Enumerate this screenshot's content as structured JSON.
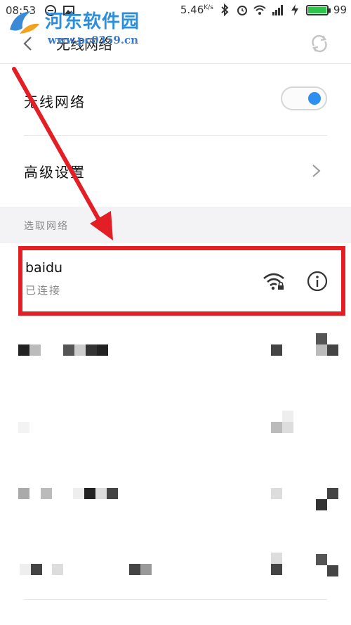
{
  "status_bar": {
    "time": "08:53",
    "net_speed": "5.46",
    "net_speed_unit": "K/s",
    "battery_level": "99",
    "battery_fraction": 0.99
  },
  "watermark": {
    "title": "河东软件园",
    "url": "www.pc0359.cn"
  },
  "header": {
    "title": "无线网络",
    "back_icon": "back-arrow-icon",
    "refresh_icon": "refresh-icon"
  },
  "settings": {
    "wifi_label": "无线网络",
    "wifi_enabled": true,
    "advanced_label": "高级设置"
  },
  "section": {
    "title": "选取网络"
  },
  "connected_network": {
    "ssid": "baidu",
    "status": "已连接"
  },
  "colors": {
    "accent": "#2d8ff0",
    "highlight_border": "#e41e25",
    "arrow": "#e41e25",
    "battery": "#2ec34a"
  }
}
